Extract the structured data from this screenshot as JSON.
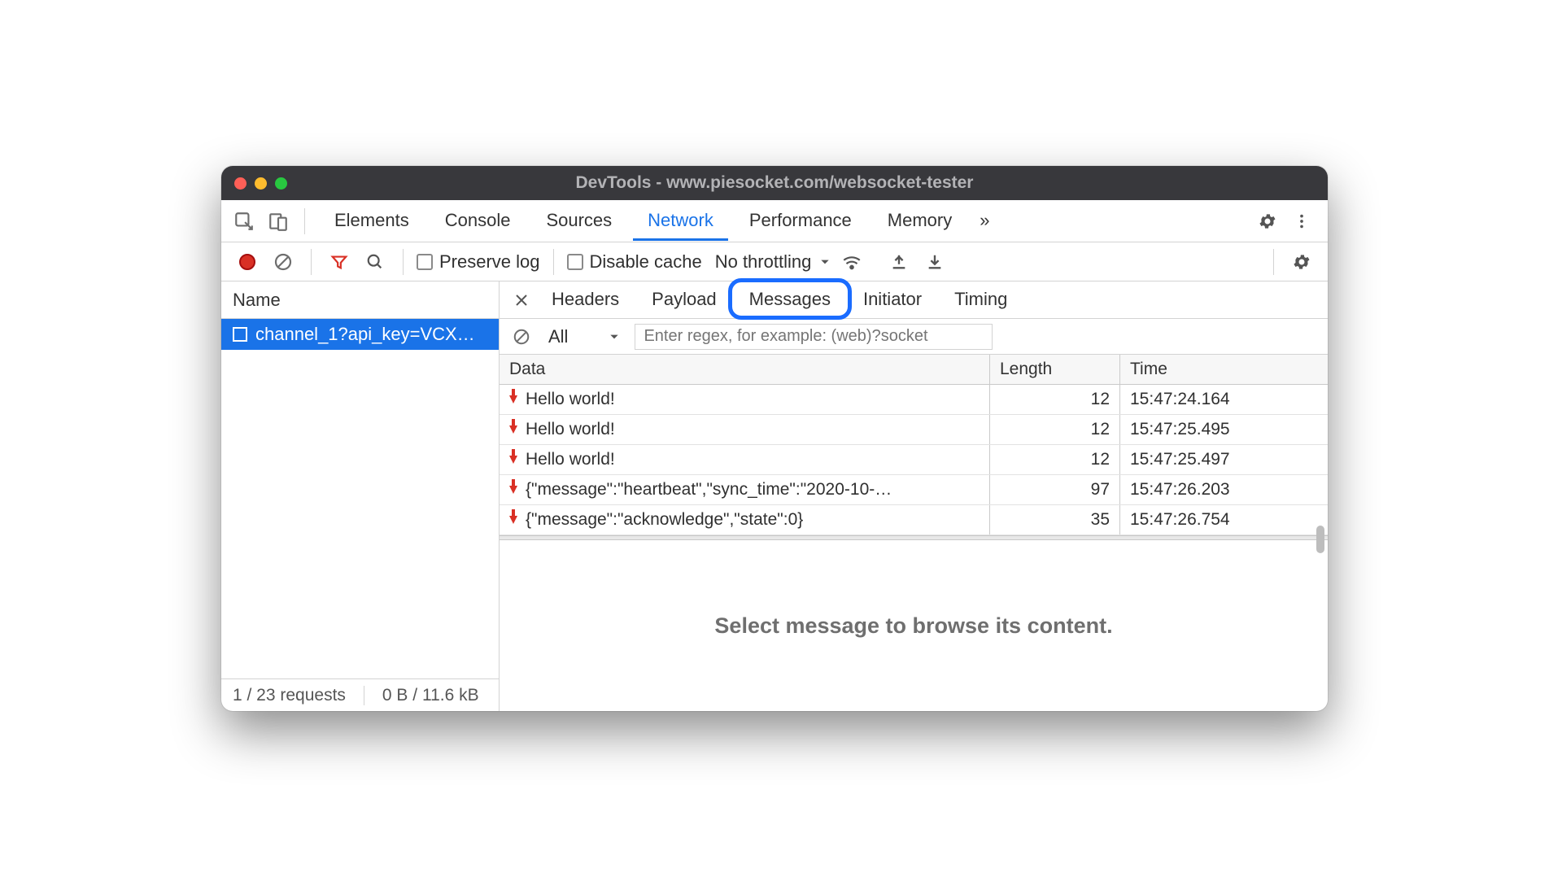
{
  "window": {
    "title": "DevTools - www.piesocket.com/websocket-tester"
  },
  "mainTabs": {
    "items": [
      "Elements",
      "Console",
      "Sources",
      "Network",
      "Performance",
      "Memory"
    ],
    "active": "Network",
    "overflow": "»"
  },
  "toolbar": {
    "preserve_log": "Preserve log",
    "disable_cache": "Disable cache",
    "throttling": "No throttling"
  },
  "left": {
    "header": "Name",
    "request": "channel_1?api_key=VCX…",
    "status_requests": "1 / 23 requests",
    "status_bytes": "0 B / 11.6 kB"
  },
  "subTabs": {
    "items": [
      "Headers",
      "Payload",
      "Messages",
      "Initiator",
      "Timing"
    ],
    "active": "Messages"
  },
  "filter": {
    "type": "All",
    "regex_placeholder": "Enter regex, for example: (web)?socket"
  },
  "messages": {
    "columns": {
      "data": "Data",
      "length": "Length",
      "time": "Time"
    },
    "rows": [
      {
        "dir": "down",
        "data": "Hello world!",
        "length": "12",
        "time": "15:47:24.164"
      },
      {
        "dir": "down",
        "data": "Hello world!",
        "length": "12",
        "time": "15:47:25.495"
      },
      {
        "dir": "down",
        "data": "Hello world!",
        "length": "12",
        "time": "15:47:25.497"
      },
      {
        "dir": "down",
        "data": "{\"message\":\"heartbeat\",\"sync_time\":\"2020-10-…",
        "length": "97",
        "time": "15:47:26.203"
      },
      {
        "dir": "down",
        "data": "{\"message\":\"acknowledge\",\"state\":0}",
        "length": "35",
        "time": "15:47:26.754"
      }
    ],
    "placeholder": "Select message to browse its content."
  }
}
